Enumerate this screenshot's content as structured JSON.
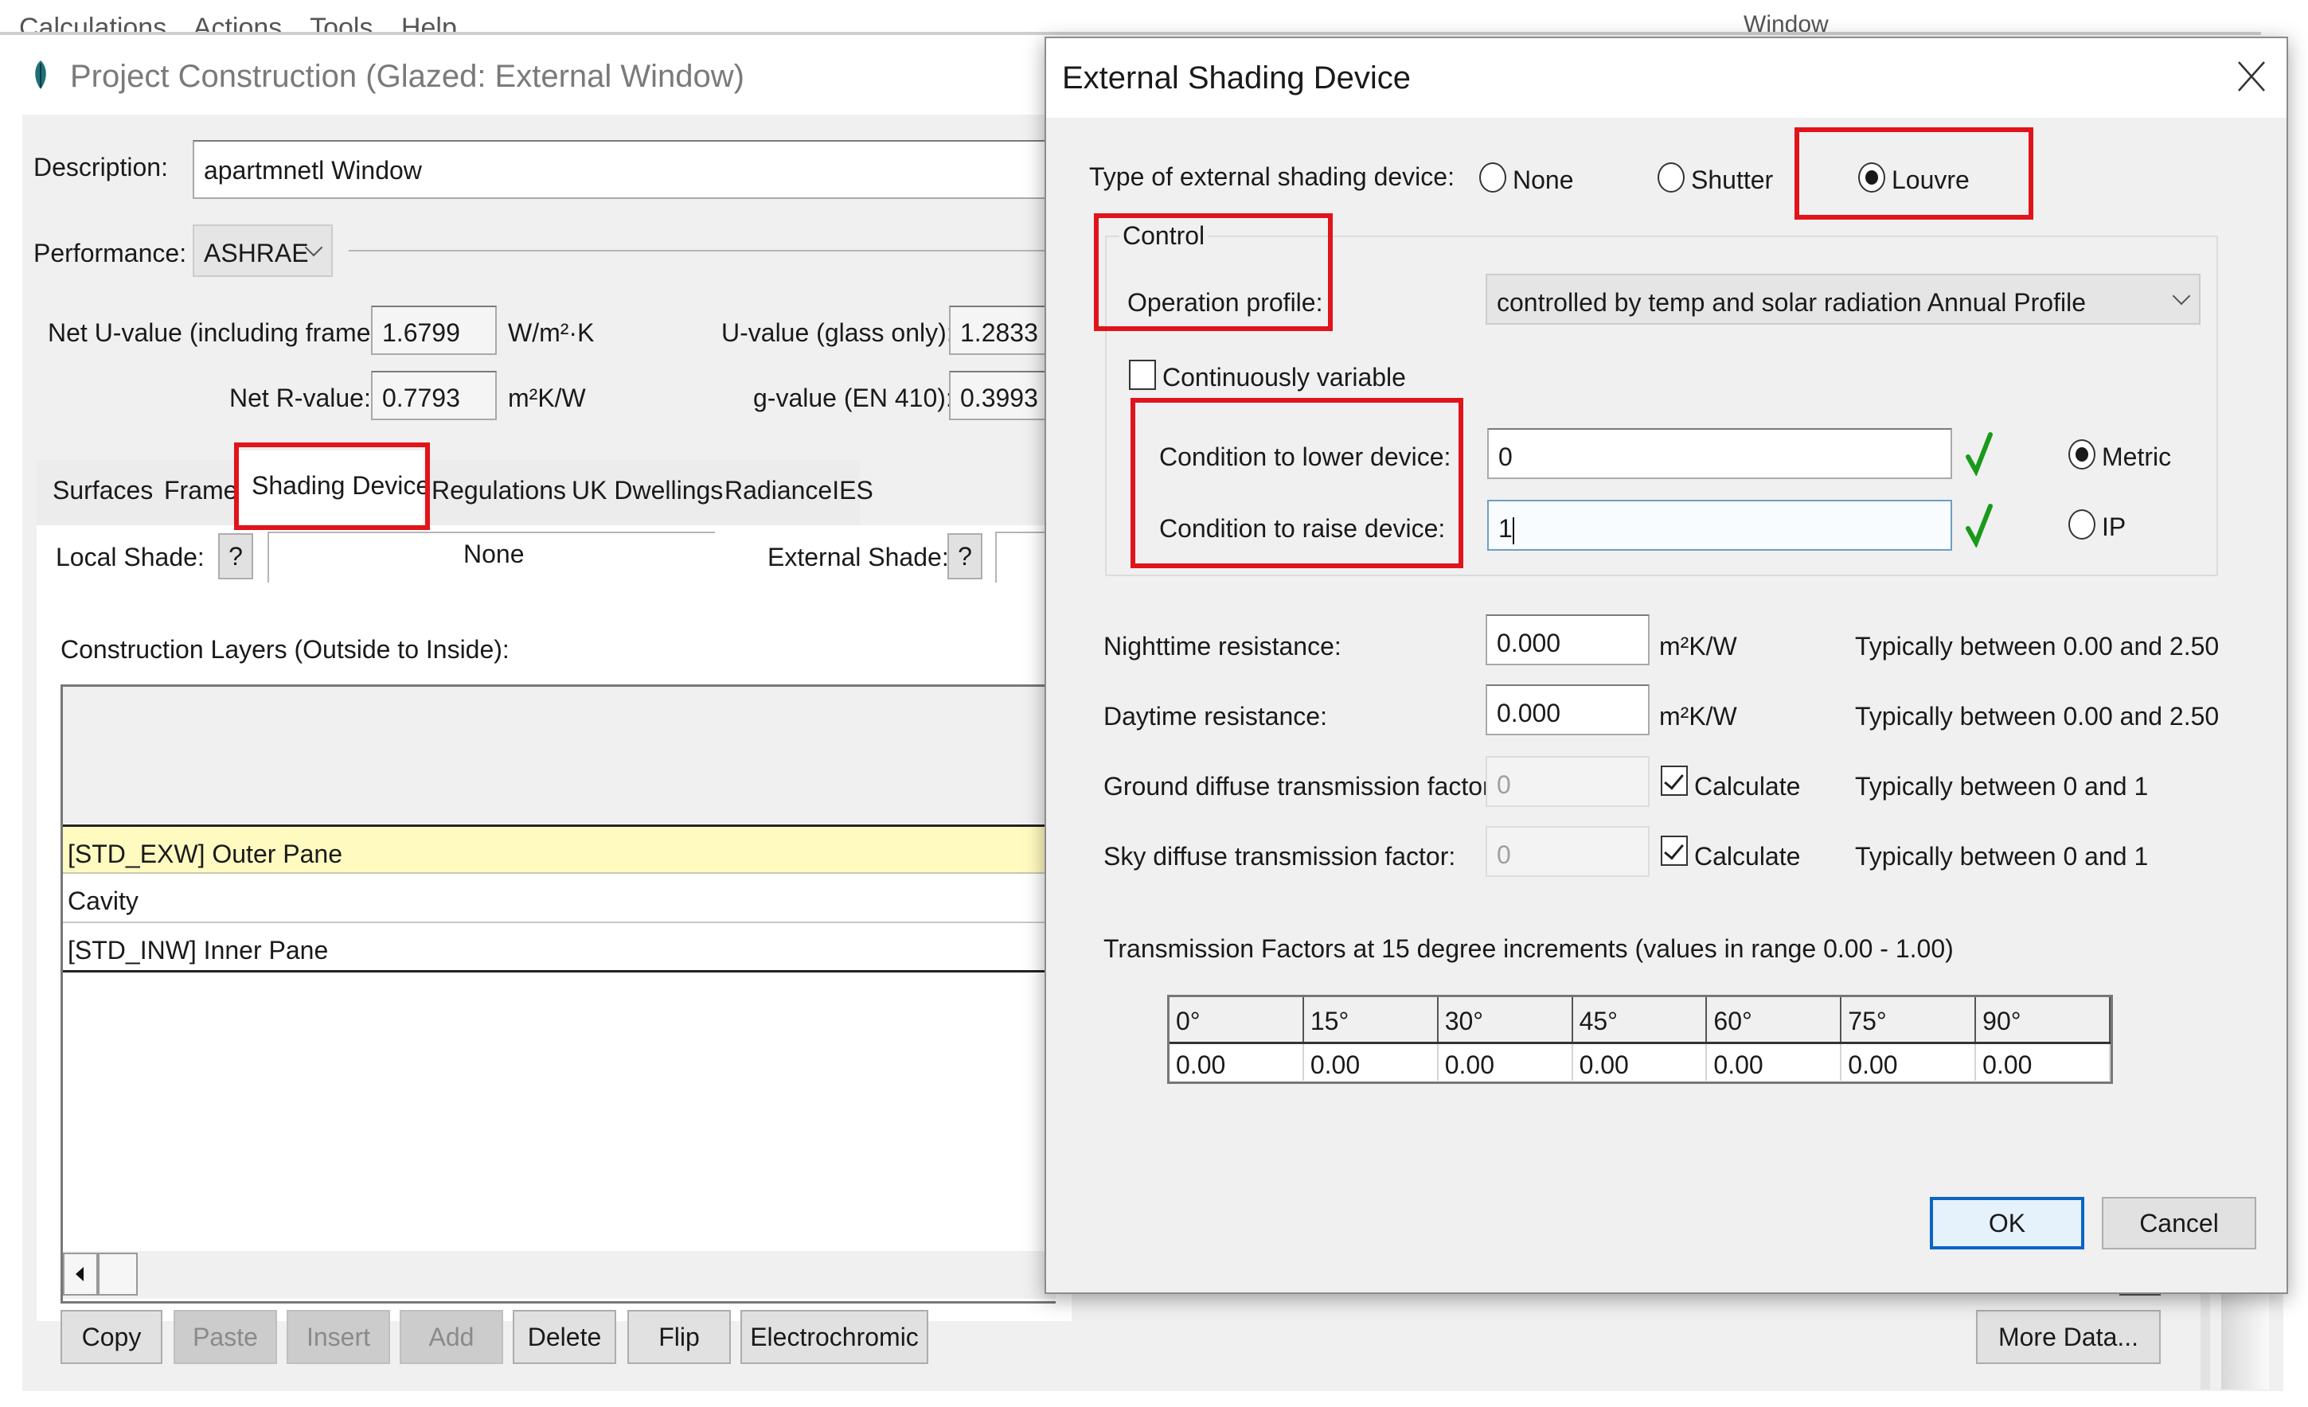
{
  "menu": {
    "visible_text": "Calculations Actions Tools Help",
    "window_label_fragment": "Window"
  },
  "main_window": {
    "title": "Project Construction (Glazed: External Window)",
    "icon": "leaf-icon",
    "description_label": "Description:",
    "description_value": "apartmnetl Window",
    "performance_label": "Performance:",
    "performance_value": "ASHRAE",
    "net_u_label": "Net U-value (including frame):",
    "net_u_value": "1.6799",
    "net_u_unit": "W/m²·K",
    "u_glass_label": "U-value (glass only):",
    "u_glass_value": "1.2833",
    "net_r_label": "Net R-value:",
    "net_r_value": "0.7793",
    "net_r_unit": "m²K/W",
    "g_value_label": "g-value (EN 410):",
    "g_value_value": "0.3993",
    "tabs": [
      {
        "label": "Surfaces",
        "active": false
      },
      {
        "label": "Frame",
        "active": false
      },
      {
        "label": "Shading Device",
        "active": true
      },
      {
        "label": "Regulations",
        "active": false
      },
      {
        "label": "UK Dwellings",
        "active": false
      },
      {
        "label": "RadianceIES",
        "active": false
      }
    ],
    "local_shade_label": "Local Shade:",
    "local_shade_help": "?",
    "local_shade_value": "None",
    "external_shade_label": "External Shade:",
    "external_shade_help": "?",
    "layers_label": "Construction Layers (Outside to Inside):",
    "layers": [
      {
        "name": "[STD_EXW] Outer Pane",
        "selected": true
      },
      {
        "name": "Cavity",
        "selected": false
      },
      {
        "name": "[STD_INW] Inner Pane",
        "selected": false
      }
    ],
    "buttons": [
      {
        "label": "Copy",
        "enabled": true
      },
      {
        "label": "Paste",
        "enabled": false
      },
      {
        "label": "Insert",
        "enabled": false
      },
      {
        "label": "Add",
        "enabled": false
      },
      {
        "label": "Delete",
        "enabled": true
      },
      {
        "label": "Flip",
        "enabled": true
      },
      {
        "label": "Electrochromic",
        "enabled": true
      }
    ],
    "more_data_label": "More Data..."
  },
  "dialog": {
    "title": "External Shading Device",
    "close_icon": "close-icon",
    "type_label": "Type of external shading device:",
    "type_options": [
      {
        "label": "None",
        "selected": false
      },
      {
        "label": "Shutter",
        "selected": false
      },
      {
        "label": "Louvre",
        "selected": true
      }
    ],
    "control_group_label": "Control",
    "operation_profile_label": "Operation profile:",
    "operation_profile_value": "controlled by temp and solar radiation  Annual Profile",
    "continuously_variable_label": "Continuously variable",
    "continuously_variable_checked": false,
    "lower_label": "Condition to lower device:",
    "lower_value": "0",
    "raise_label": "Condition to raise device:",
    "raise_value": "1",
    "units_options": [
      {
        "label": "Metric",
        "selected": true
      },
      {
        "label": "IP",
        "selected": false
      }
    ],
    "nighttime_label": "Nighttime resistance:",
    "nighttime_value": "0.000",
    "nighttime_unit": "m²K/W",
    "nighttime_hint": "Typically between 0.00 and 2.50",
    "daytime_label": "Daytime resistance:",
    "daytime_value": "0.000",
    "daytime_unit": "m²K/W",
    "daytime_hint": "Typically between 0.00 and 2.50",
    "ground_label": "Ground diffuse transmission factor:",
    "ground_value": "0",
    "ground_calc_label": "Calculate",
    "ground_calc_checked": true,
    "ground_hint": "Typically between 0 and 1",
    "sky_label": "Sky diffuse transmission factor:",
    "sky_value": "0",
    "sky_calc_label": "Calculate",
    "sky_calc_checked": true,
    "sky_hint": "Typically between 0 and 1",
    "tf_label": "Transmission Factors at 15 degree increments (values in range  0.00 - 1.00)",
    "tf_angles": [
      "0°",
      "15°",
      "30°",
      "45°",
      "60°",
      "75°",
      "90°"
    ],
    "tf_values": [
      "0.00",
      "0.00",
      "0.00",
      "0.00",
      "0.00",
      "0.00",
      "0.00"
    ],
    "ok_label": "OK",
    "cancel_label": "Cancel"
  },
  "colors": {
    "highlight_red": "#e0141a",
    "check_green": "#1a9a1a",
    "selected_row": "#fffbc0",
    "default_button_border": "#0a64c4"
  }
}
